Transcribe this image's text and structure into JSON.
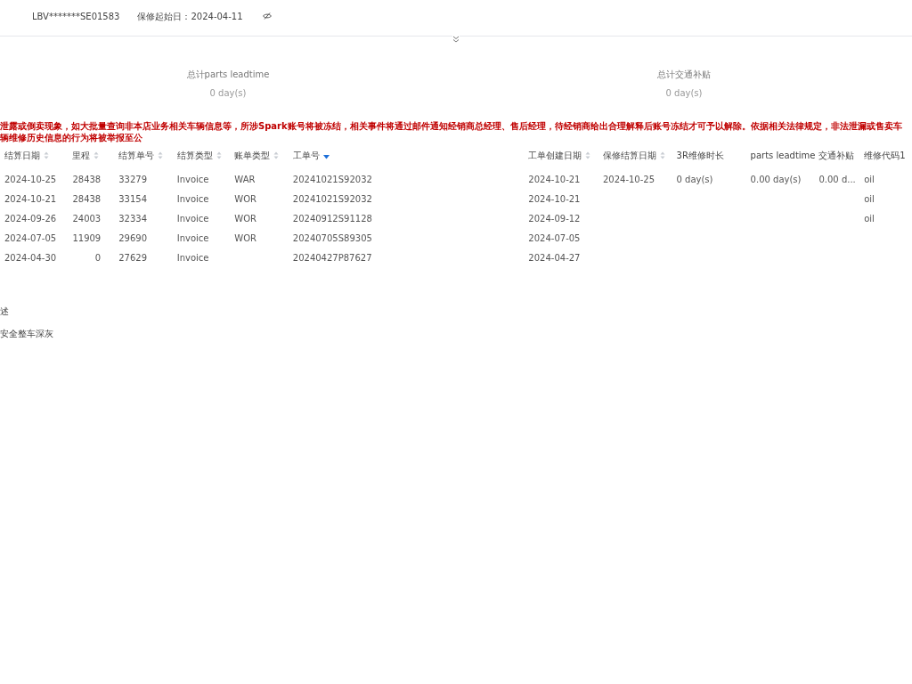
{
  "header": {
    "vin": "LBV*******SE01583",
    "warranty_start": "保修起始日：2024-04-11"
  },
  "summary": [
    {
      "label": "总计parts leadtime",
      "value": "0 day(s)"
    },
    {
      "label": "总计交通补贴",
      "value": "0 day(s)"
    }
  ],
  "warning": "泄露或倒卖现象，如大批量查询非本店业务相关车辆信息等，所涉Spark账号将被冻结，相关事件将通过邮件通知经销商总经理、售后经理，待经销商给出合理解释后账号冻结才可予以解除。依据相关法律规定，非法泄漏或售卖车辆维修历史信息的行为将被举报至公",
  "table": {
    "columns": [
      {
        "label": "结算日期",
        "sortable": true,
        "sorted": false
      },
      {
        "label": "里程",
        "sortable": true,
        "sorted": false
      },
      {
        "label": "结算单号",
        "sortable": true,
        "sorted": false
      },
      {
        "label": "结算类型",
        "sortable": true,
        "sorted": false
      },
      {
        "label": "账单类型",
        "sortable": true,
        "sorted": false
      },
      {
        "label": "工单号",
        "sortable": true,
        "sorted": true
      },
      {
        "label": "工单创建日期",
        "sortable": true,
        "sorted": false
      },
      {
        "label": "保修结算日期",
        "sortable": true,
        "sorted": false
      },
      {
        "label": "3R维修时长",
        "sortable": false
      },
      {
        "label": "parts leadtime",
        "sortable": false
      },
      {
        "label": "交通补贴",
        "sortable": false
      },
      {
        "label": "维修代码1",
        "sortable": false
      }
    ],
    "rows": [
      [
        "2024-10-25",
        "28438",
        "33279",
        "Invoice",
        "WAR",
        "20241021S92032",
        "2024-10-21",
        "2024-10-25",
        "0 day(s)",
        "0.00 day(s)",
        "0.00 d...",
        "oil"
      ],
      [
        "2024-10-21",
        "28438",
        "33154",
        "Invoice",
        "WOR",
        "20241021S92032",
        "2024-10-21",
        "",
        "",
        "",
        "",
        "oil"
      ],
      [
        "2024-09-26",
        "24003",
        "32334",
        "Invoice",
        "WOR",
        "20240912S91128",
        "2024-09-12",
        "",
        "",
        "",
        "",
        "oil"
      ],
      [
        "2024-07-05",
        "11909",
        "29690",
        "Invoice",
        "WOR",
        "20240705S89305",
        "2024-07-05",
        "",
        "",
        "",
        "",
        ""
      ],
      [
        "2024-04-30",
        "0",
        "27629",
        "Invoice",
        "",
        "20240427P87627",
        "2024-04-27",
        "",
        "",
        "",
        "",
        ""
      ]
    ]
  },
  "details": [
    "述",
    "安全整车深灰"
  ]
}
